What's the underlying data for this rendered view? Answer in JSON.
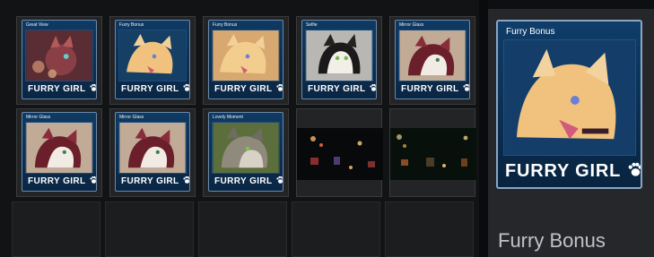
{
  "cards": [
    {
      "title": "Great View",
      "logo": "FURRY GIRL",
      "icon": "paw-icon",
      "art": "maroon-dark"
    },
    {
      "title": "Furry Bonus",
      "logo": "FURRY GIRL",
      "icon": "paw-icon",
      "art": "blonde-blue"
    },
    {
      "title": "Furry Bonus",
      "logo": "FURRY GIRL",
      "icon": "paw-icon",
      "art": "blonde-tan"
    },
    {
      "title": "Selfie",
      "logo": "FURRY GIRL",
      "icon": "paw-icon",
      "art": "black-white"
    },
    {
      "title": "Mirror Glass",
      "logo": "FURRY GIRL",
      "icon": "paw-icon",
      "art": "maroon-light"
    },
    {
      "title": "Mirror Glass",
      "logo": "FURRY GIRL",
      "icon": "paw-icon",
      "art": "maroon-light"
    },
    {
      "title": "Mirror Glass",
      "logo": "FURRY GIRL",
      "icon": "paw-icon",
      "art": "maroon-light"
    },
    {
      "title": "Lovely Moment",
      "logo": "FURRY GIRL",
      "icon": "paw-icon",
      "art": "gray-green"
    }
  ],
  "screenshots": [
    {
      "name": "screenshot-dark-red"
    },
    {
      "name": "screenshot-dark-green"
    }
  ],
  "preview": {
    "title": "Furry Bonus",
    "logo": "FURRY GIRL",
    "icon": "paw-icon"
  },
  "selected_name": "Furry Bonus"
}
